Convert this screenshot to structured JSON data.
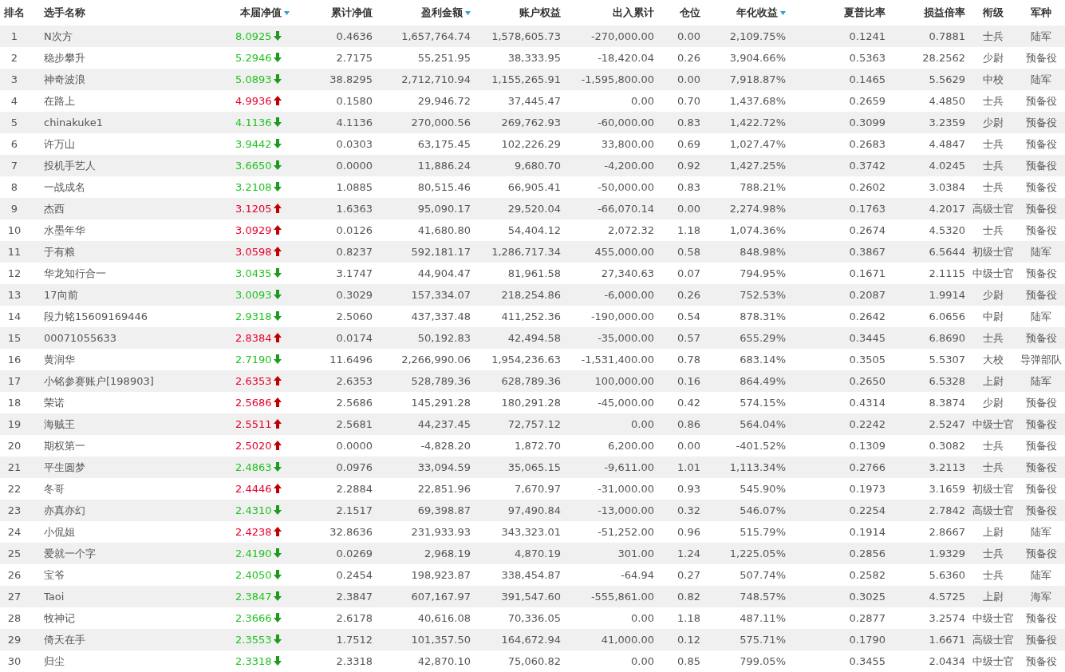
{
  "table": {
    "columns": [
      {
        "label": "排名",
        "sortable": false
      },
      {
        "label": "选手名称",
        "sortable": false
      },
      {
        "label": "本届净值",
        "sortable": true
      },
      {
        "label": "累计净值",
        "sortable": false
      },
      {
        "label": "盈利金额",
        "sortable": true
      },
      {
        "label": "账户权益",
        "sortable": false
      },
      {
        "label": "出入累计",
        "sortable": false
      },
      {
        "label": "仓位",
        "sortable": false
      },
      {
        "label": "年化收益",
        "sortable": true
      },
      {
        "label": "夏普比率",
        "sortable": false
      },
      {
        "label": "损益倍率",
        "sortable": false
      },
      {
        "label": "衔级",
        "sortable": false
      },
      {
        "label": "军种",
        "sortable": false
      }
    ],
    "rows": [
      {
        "rising": false,
        "cells": [
          "1",
          "N次方",
          "8.0925",
          "0.4636",
          "1,657,764.74",
          "1,578,605.73",
          "-270,000.00",
          "0.00",
          "2,109.75%",
          "0.1241",
          "0.7881",
          "士兵",
          "陆军"
        ]
      },
      {
        "rising": false,
        "cells": [
          "2",
          "稳步攀升",
          "5.2946",
          "2.7175",
          "55,251.95",
          "38,333.95",
          "-18,420.04",
          "0.26",
          "3,904.66%",
          "0.5363",
          "28.2562",
          "少尉",
          "预备役"
        ]
      },
      {
        "rising": false,
        "cells": [
          "3",
          "神奇波浪",
          "5.0893",
          "38.8295",
          "2,712,710.94",
          "1,155,265.91",
          "-1,595,800.00",
          "0.00",
          "7,918.87%",
          "0.1465",
          "5.5629",
          "中校",
          "陆军"
        ]
      },
      {
        "rising": true,
        "cells": [
          "4",
          "在路上",
          "4.9936",
          "0.1580",
          "29,946.72",
          "37,445.47",
          "0.00",
          "0.70",
          "1,437.68%",
          "0.2659",
          "4.4850",
          "士兵",
          "预备役"
        ]
      },
      {
        "rising": false,
        "cells": [
          "5",
          "chinakuke1",
          "4.1136",
          "4.1136",
          "270,000.56",
          "269,762.93",
          "-60,000.00",
          "0.83",
          "1,422.72%",
          "0.3099",
          "3.2359",
          "少尉",
          "预备役"
        ]
      },
      {
        "rising": false,
        "cells": [
          "6",
          "许万山",
          "3.9442",
          "0.0303",
          "63,175.45",
          "102,226.29",
          "33,800.00",
          "0.69",
          "1,027.47%",
          "0.2683",
          "4.4847",
          "士兵",
          "预备役"
        ]
      },
      {
        "rising": false,
        "cells": [
          "7",
          "投机手艺人",
          "3.6650",
          "0.0000",
          "11,886.24",
          "9,680.70",
          "-4,200.00",
          "0.92",
          "1,427.25%",
          "0.3742",
          "4.0245",
          "士兵",
          "预备役"
        ]
      },
      {
        "rising": false,
        "cells": [
          "8",
          "一战成名",
          "3.2108",
          "1.0885",
          "80,515.46",
          "66,905.41",
          "-50,000.00",
          "0.83",
          "788.21%",
          "0.2602",
          "3.0384",
          "士兵",
          "预备役"
        ]
      },
      {
        "rising": true,
        "cells": [
          "9",
          "杰西",
          "3.1205",
          "1.6363",
          "95,090.17",
          "29,520.04",
          "-66,070.14",
          "0.00",
          "2,274.98%",
          "0.1763",
          "4.2017",
          "高级士官",
          "预备役"
        ]
      },
      {
        "rising": true,
        "cells": [
          "10",
          "水墨年华",
          "3.0929",
          "0.0126",
          "41,680.80",
          "54,404.12",
          "2,072.32",
          "1.18",
          "1,074.36%",
          "0.2674",
          "4.5320",
          "士兵",
          "预备役"
        ]
      },
      {
        "rising": true,
        "cells": [
          "11",
          "于有粮",
          "3.0598",
          "0.8237",
          "592,181.17",
          "1,286,717.34",
          "455,000.00",
          "0.58",
          "848.98%",
          "0.3867",
          "6.5644",
          "初级士官",
          "陆军"
        ]
      },
      {
        "rising": false,
        "cells": [
          "12",
          "华龙知行合一",
          "3.0435",
          "3.1747",
          "44,904.47",
          "81,961.58",
          "27,340.63",
          "0.07",
          "794.95%",
          "0.1671",
          "2.1115",
          "中级士官",
          "预备役"
        ]
      },
      {
        "rising": false,
        "cells": [
          "13",
          "17向前",
          "3.0093",
          "0.3029",
          "157,334.07",
          "218,254.86",
          "-6,000.00",
          "0.26",
          "752.53%",
          "0.2087",
          "1.9914",
          "少尉",
          "预备役"
        ]
      },
      {
        "rising": false,
        "cells": [
          "14",
          "段力铭15609169446",
          "2.9318",
          "2.5060",
          "437,337.48",
          "411,252.36",
          "-190,000.00",
          "0.54",
          "878.31%",
          "0.2642",
          "6.0656",
          "中尉",
          "陆军"
        ]
      },
      {
        "rising": true,
        "cells": [
          "15",
          "00071055633",
          "2.8384",
          "0.0174",
          "50,192.83",
          "42,494.58",
          "-35,000.00",
          "0.57",
          "655.29%",
          "0.3445",
          "6.8690",
          "士兵",
          "预备役"
        ]
      },
      {
        "rising": false,
        "cells": [
          "16",
          "黄润华",
          "2.7190",
          "11.6496",
          "2,266,990.06",
          "1,954,236.63",
          "-1,531,400.00",
          "0.78",
          "683.14%",
          "0.3505",
          "5.5307",
          "大校",
          "导弹部队"
        ]
      },
      {
        "rising": true,
        "cells": [
          "17",
          "小铭参赛账户[198903]",
          "2.6353",
          "2.6353",
          "528,789.36",
          "628,789.36",
          "100,000.00",
          "0.16",
          "864.49%",
          "0.2650",
          "6.5328",
          "上尉",
          "陆军"
        ]
      },
      {
        "rising": true,
        "cells": [
          "18",
          "荣诺",
          "2.5686",
          "2.5686",
          "145,291.28",
          "180,291.28",
          "-45,000.00",
          "0.42",
          "574.15%",
          "0.4314",
          "8.3874",
          "少尉",
          "预备役"
        ]
      },
      {
        "rising": true,
        "cells": [
          "19",
          "海贼王",
          "2.5511",
          "2.5681",
          "44,237.45",
          "72,757.12",
          "0.00",
          "0.86",
          "564.04%",
          "0.2242",
          "2.5247",
          "中级士官",
          "预备役"
        ]
      },
      {
        "rising": true,
        "cells": [
          "20",
          "期权第一",
          "2.5020",
          "0.0000",
          "-4,828.20",
          "1,872.70",
          "6,200.00",
          "0.00",
          "-401.52%",
          "0.1309",
          "0.3082",
          "士兵",
          "预备役"
        ]
      },
      {
        "rising": false,
        "cells": [
          "21",
          "平生圆梦",
          "2.4863",
          "0.0976",
          "33,094.59",
          "35,065.15",
          "-9,611.00",
          "1.01",
          "1,113.34%",
          "0.2766",
          "3.2113",
          "士兵",
          "预备役"
        ]
      },
      {
        "rising": true,
        "cells": [
          "22",
          "冬哥",
          "2.4446",
          "2.2884",
          "22,851.96",
          "7,670.97",
          "-31,000.00",
          "0.93",
          "545.90%",
          "0.1973",
          "3.1659",
          "初级士官",
          "预备役"
        ]
      },
      {
        "rising": false,
        "cells": [
          "23",
          "亦真亦幻",
          "2.4310",
          "2.1517",
          "69,398.87",
          "97,490.84",
          "-13,000.00",
          "0.32",
          "546.07%",
          "0.2254",
          "2.7842",
          "高级士官",
          "预备役"
        ]
      },
      {
        "rising": true,
        "cells": [
          "24",
          "小侃姐",
          "2.4238",
          "32.8636",
          "231,933.93",
          "343,323.01",
          "-51,252.00",
          "0.96",
          "515.79%",
          "0.1914",
          "2.8667",
          "上尉",
          "陆军"
        ]
      },
      {
        "rising": false,
        "cells": [
          "25",
          "爱就一个字",
          "2.4190",
          "0.0269",
          "2,968.19",
          "4,870.19",
          "301.00",
          "1.24",
          "1,225.05%",
          "0.2856",
          "1.9329",
          "士兵",
          "预备役"
        ]
      },
      {
        "rising": false,
        "cells": [
          "26",
          "宝爷",
          "2.4050",
          "0.2454",
          "198,923.87",
          "338,454.87",
          "-64.94",
          "0.27",
          "507.74%",
          "0.2582",
          "5.6360",
          "士兵",
          "陆军"
        ]
      },
      {
        "rising": false,
        "cells": [
          "27",
          "Taoi",
          "2.3847",
          "2.3847",
          "607,167.97",
          "391,547.60",
          "-555,861.00",
          "0.82",
          "748.57%",
          "0.3025",
          "4.5725",
          "上尉",
          "海军"
        ]
      },
      {
        "rising": false,
        "cells": [
          "28",
          "牧神记",
          "2.3666",
          "2.6178",
          "40,616.08",
          "70,336.05",
          "0.00",
          "1.18",
          "487.11%",
          "0.2877",
          "3.2574",
          "中级士官",
          "预备役"
        ]
      },
      {
        "rising": false,
        "cells": [
          "29",
          "倚天在手",
          "2.3553",
          "1.7512",
          "101,357.50",
          "164,672.94",
          "41,000.00",
          "0.12",
          "575.71%",
          "0.1790",
          "1.6671",
          "高级士官",
          "预备役"
        ]
      },
      {
        "rising": false,
        "cells": [
          "30",
          "归尘",
          "2.3318",
          "2.3318",
          "42,870.10",
          "75,060.82",
          "0.00",
          "0.85",
          "799.05%",
          "0.3455",
          "2.0434",
          "中级士官",
          "预备役"
        ]
      }
    ]
  }
}
